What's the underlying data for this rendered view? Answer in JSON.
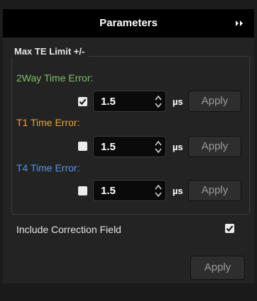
{
  "header": {
    "title": "Parameters",
    "collapse_icon": "double-chevron-right-icon"
  },
  "max_te": {
    "legend": "Max TE Limit +/-",
    "rows": [
      {
        "label": "2Way Time Error:",
        "label_color": "#7fbf6a",
        "checked": true,
        "value": "1.5",
        "unit": "µs",
        "apply_label": "Apply"
      },
      {
        "label": "T1 Time Error:",
        "label_color": "#e9a23b",
        "checked": false,
        "value": "1.5",
        "unit": "µs",
        "apply_label": "Apply"
      },
      {
        "label": "T4 Time Error:",
        "label_color": "#5b8fe8",
        "checked": false,
        "value": "1.5",
        "unit": "µs",
        "apply_label": "Apply"
      }
    ]
  },
  "include_correction": {
    "label": "Include Correction Field",
    "checked": true
  },
  "footer": {
    "apply_label": "Apply"
  }
}
